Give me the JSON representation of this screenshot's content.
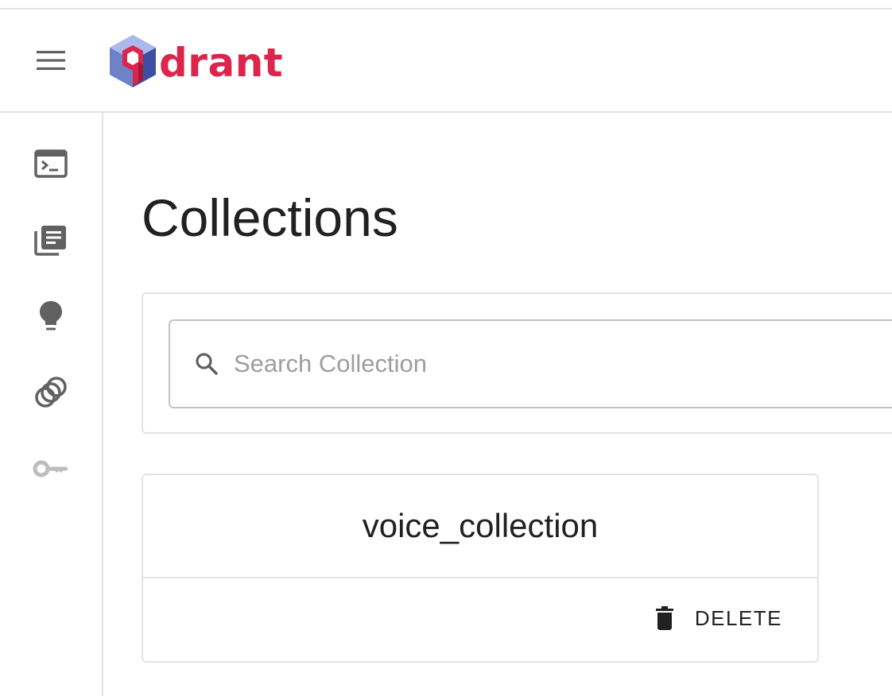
{
  "app": {
    "logo_text": "drant",
    "brand_color": "#dc244c"
  },
  "appbar": {
    "menu_icon": "hamburger-menu-icon"
  },
  "sidebar": {
    "items": [
      {
        "icon": "terminal-console-icon"
      },
      {
        "icon": "library-books-icon"
      },
      {
        "icon": "lightbulb-icon"
      },
      {
        "icon": "workspaces-rings-icon"
      },
      {
        "icon": "key-icon"
      }
    ]
  },
  "main": {
    "title": "Collections",
    "search": {
      "value": "",
      "placeholder": "Search Collection",
      "icon": "search-icon"
    },
    "collections": [
      {
        "name": "voice_collection",
        "delete_label": "DELETE",
        "delete_icon": "trash-icon"
      }
    ]
  }
}
